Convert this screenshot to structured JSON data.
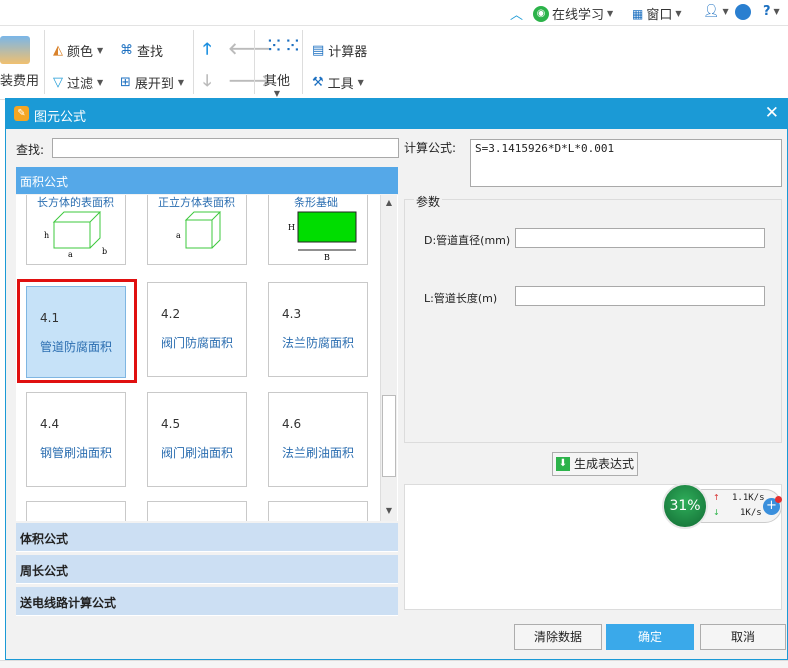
{
  "topbar": {
    "online": "在线学习",
    "window": "窗口"
  },
  "ribbon": {
    "partial_left": "装费用",
    "color": "颜色",
    "find": "查找",
    "filter": "过滤",
    "expand": "展开到",
    "other": "其他",
    "calculator": "计算器",
    "tools": "工具"
  },
  "dialog": {
    "title": "图元公式",
    "search_label": "查找:",
    "search_value": "",
    "category_active": "面积公式",
    "partial_top": [
      "长方体的表面积",
      "正立方体表面积",
      "条形基础"
    ],
    "tiles": [
      {
        "num": "4.1",
        "name": "管道防腐面积"
      },
      {
        "num": "4.2",
        "name": "阀门防腐面积"
      },
      {
        "num": "4.3",
        "name": "法兰防腐面积"
      },
      {
        "num": "4.4",
        "name": "钢管刷油面积"
      },
      {
        "num": "4.5",
        "name": "阀门刷油面积"
      },
      {
        "num": "4.6",
        "name": "法兰刷油面积"
      }
    ],
    "categories": [
      "体积公式",
      "周长公式",
      "送电线路计算公式"
    ],
    "formula_label": "计算公式:",
    "formula_value": "S=3.1415926*D*L*0.001",
    "params_label": "参数",
    "param_d": "D:管道直径(mm)",
    "param_d_value": "",
    "param_l": "L:管道长度(m)",
    "param_l_value": "",
    "generate": "生成表达式",
    "clear": "清除数据",
    "ok": "确定",
    "cancel": "取消"
  },
  "netmon": {
    "percent": "31%",
    "up": "1.1K/s",
    "down": "1K/s"
  },
  "colors": {
    "accent": "#1b9ad6",
    "category": "#55a8e8",
    "selection_border": "#e01010"
  }
}
